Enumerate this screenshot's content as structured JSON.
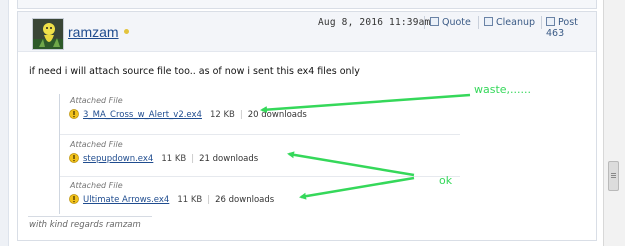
{
  "post": {
    "username": "ramzam",
    "date": "Aug 8, 2016 11:39am",
    "actions": {
      "quote": "Quote",
      "cleanup": "Cleanup",
      "post_number": "Post 463"
    },
    "message": "if need i will attach source file too.. as of now i sent this ex4 files only",
    "signature": "with kind regards ramzam"
  },
  "attachments": [
    {
      "label": "Attached File",
      "filename": "3_MA_Cross_w_Alert_v2.ex4",
      "size": "12 KB",
      "downloads": "20 downloads"
    },
    {
      "label": "Attached File",
      "filename": "stepupdown.ex4",
      "size": "11 KB",
      "downloads": "21 downloads"
    },
    {
      "label": "Attached File",
      "filename": "Ultimate Arrows.ex4",
      "size": "11 KB",
      "downloads": "26 downloads"
    }
  ],
  "annotations": {
    "waste": "waste,......",
    "ok": "ok"
  },
  "colors": {
    "annotation": "#35d85a",
    "link": "#1f4c8f",
    "warning": "#f2c21b"
  }
}
